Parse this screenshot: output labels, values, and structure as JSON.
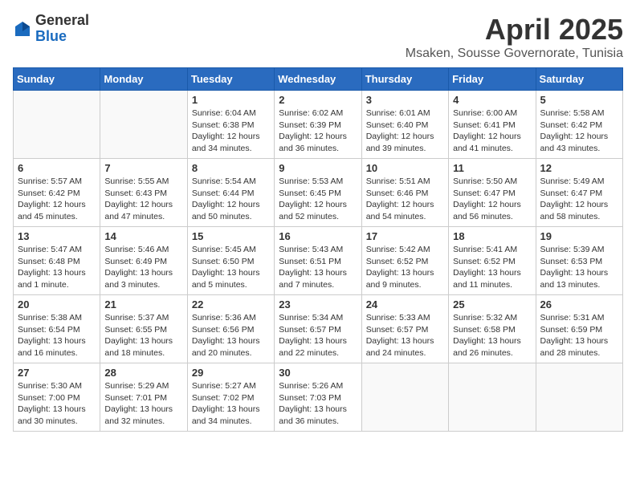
{
  "header": {
    "logo_general": "General",
    "logo_blue": "Blue",
    "month": "April 2025",
    "location": "Msaken, Sousse Governorate, Tunisia"
  },
  "weekdays": [
    "Sunday",
    "Monday",
    "Tuesday",
    "Wednesday",
    "Thursday",
    "Friday",
    "Saturday"
  ],
  "weeks": [
    [
      {
        "day": "",
        "info": ""
      },
      {
        "day": "",
        "info": ""
      },
      {
        "day": "1",
        "info": "Sunrise: 6:04 AM\nSunset: 6:38 PM\nDaylight: 12 hours and 34 minutes."
      },
      {
        "day": "2",
        "info": "Sunrise: 6:02 AM\nSunset: 6:39 PM\nDaylight: 12 hours and 36 minutes."
      },
      {
        "day": "3",
        "info": "Sunrise: 6:01 AM\nSunset: 6:40 PM\nDaylight: 12 hours and 39 minutes."
      },
      {
        "day": "4",
        "info": "Sunrise: 6:00 AM\nSunset: 6:41 PM\nDaylight: 12 hours and 41 minutes."
      },
      {
        "day": "5",
        "info": "Sunrise: 5:58 AM\nSunset: 6:42 PM\nDaylight: 12 hours and 43 minutes."
      }
    ],
    [
      {
        "day": "6",
        "info": "Sunrise: 5:57 AM\nSunset: 6:42 PM\nDaylight: 12 hours and 45 minutes."
      },
      {
        "day": "7",
        "info": "Sunrise: 5:55 AM\nSunset: 6:43 PM\nDaylight: 12 hours and 47 minutes."
      },
      {
        "day": "8",
        "info": "Sunrise: 5:54 AM\nSunset: 6:44 PM\nDaylight: 12 hours and 50 minutes."
      },
      {
        "day": "9",
        "info": "Sunrise: 5:53 AM\nSunset: 6:45 PM\nDaylight: 12 hours and 52 minutes."
      },
      {
        "day": "10",
        "info": "Sunrise: 5:51 AM\nSunset: 6:46 PM\nDaylight: 12 hours and 54 minutes."
      },
      {
        "day": "11",
        "info": "Sunrise: 5:50 AM\nSunset: 6:47 PM\nDaylight: 12 hours and 56 minutes."
      },
      {
        "day": "12",
        "info": "Sunrise: 5:49 AM\nSunset: 6:47 PM\nDaylight: 12 hours and 58 minutes."
      }
    ],
    [
      {
        "day": "13",
        "info": "Sunrise: 5:47 AM\nSunset: 6:48 PM\nDaylight: 13 hours and 1 minute."
      },
      {
        "day": "14",
        "info": "Sunrise: 5:46 AM\nSunset: 6:49 PM\nDaylight: 13 hours and 3 minutes."
      },
      {
        "day": "15",
        "info": "Sunrise: 5:45 AM\nSunset: 6:50 PM\nDaylight: 13 hours and 5 minutes."
      },
      {
        "day": "16",
        "info": "Sunrise: 5:43 AM\nSunset: 6:51 PM\nDaylight: 13 hours and 7 minutes."
      },
      {
        "day": "17",
        "info": "Sunrise: 5:42 AM\nSunset: 6:52 PM\nDaylight: 13 hours and 9 minutes."
      },
      {
        "day": "18",
        "info": "Sunrise: 5:41 AM\nSunset: 6:52 PM\nDaylight: 13 hours and 11 minutes."
      },
      {
        "day": "19",
        "info": "Sunrise: 5:39 AM\nSunset: 6:53 PM\nDaylight: 13 hours and 13 minutes."
      }
    ],
    [
      {
        "day": "20",
        "info": "Sunrise: 5:38 AM\nSunset: 6:54 PM\nDaylight: 13 hours and 16 minutes."
      },
      {
        "day": "21",
        "info": "Sunrise: 5:37 AM\nSunset: 6:55 PM\nDaylight: 13 hours and 18 minutes."
      },
      {
        "day": "22",
        "info": "Sunrise: 5:36 AM\nSunset: 6:56 PM\nDaylight: 13 hours and 20 minutes."
      },
      {
        "day": "23",
        "info": "Sunrise: 5:34 AM\nSunset: 6:57 PM\nDaylight: 13 hours and 22 minutes."
      },
      {
        "day": "24",
        "info": "Sunrise: 5:33 AM\nSunset: 6:57 PM\nDaylight: 13 hours and 24 minutes."
      },
      {
        "day": "25",
        "info": "Sunrise: 5:32 AM\nSunset: 6:58 PM\nDaylight: 13 hours and 26 minutes."
      },
      {
        "day": "26",
        "info": "Sunrise: 5:31 AM\nSunset: 6:59 PM\nDaylight: 13 hours and 28 minutes."
      }
    ],
    [
      {
        "day": "27",
        "info": "Sunrise: 5:30 AM\nSunset: 7:00 PM\nDaylight: 13 hours and 30 minutes."
      },
      {
        "day": "28",
        "info": "Sunrise: 5:29 AM\nSunset: 7:01 PM\nDaylight: 13 hours and 32 minutes."
      },
      {
        "day": "29",
        "info": "Sunrise: 5:27 AM\nSunset: 7:02 PM\nDaylight: 13 hours and 34 minutes."
      },
      {
        "day": "30",
        "info": "Sunrise: 5:26 AM\nSunset: 7:03 PM\nDaylight: 13 hours and 36 minutes."
      },
      {
        "day": "",
        "info": ""
      },
      {
        "day": "",
        "info": ""
      },
      {
        "day": "",
        "info": ""
      }
    ]
  ]
}
